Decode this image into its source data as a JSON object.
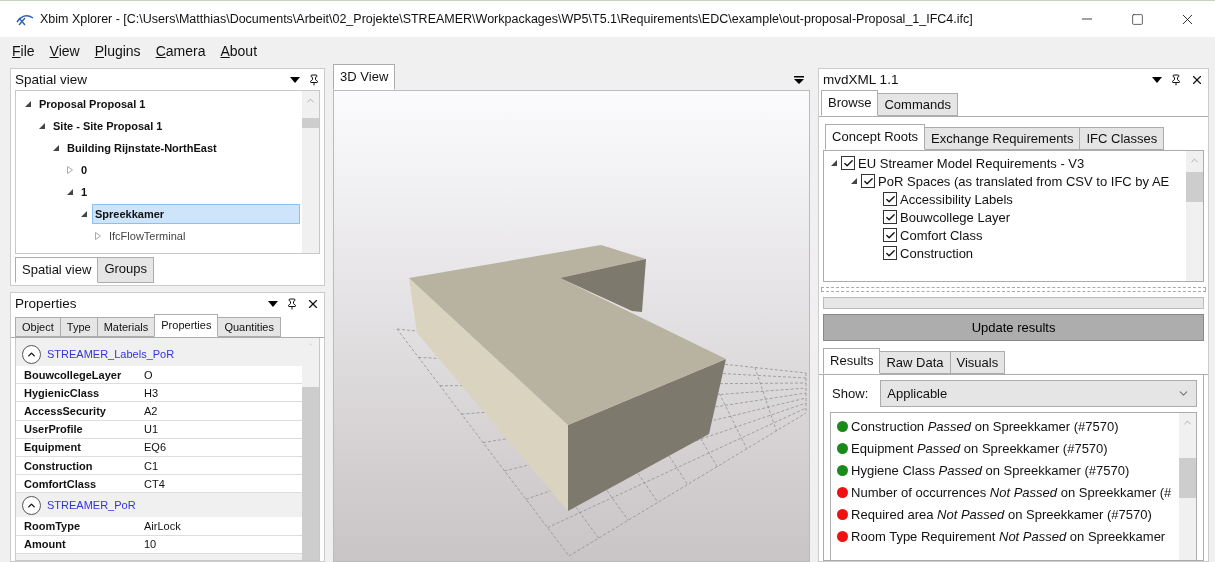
{
  "window": {
    "title": "Xbim Xplorer - [C:\\Users\\Matthias\\Documents\\Arbeit\\02_Projekte\\STREAMER\\Workpackages\\WP5\\T5.1\\Requirements\\EDC\\example\\out-proposal-Proposal_1_IFC4.ifc]"
  },
  "menu": [
    {
      "label": "File"
    },
    {
      "label": "View"
    },
    {
      "label": "Plugins"
    },
    {
      "label": "Camera"
    },
    {
      "label": "About"
    }
  ],
  "spatial_view": {
    "title": "Spatial view",
    "tree": [
      {
        "label": "Proposal Proposal 1",
        "kind": "spatial",
        "expanded": true,
        "selected": false,
        "children": [
          {
            "label": "Site - Site Proposal 1",
            "kind": "spatial",
            "expanded": true,
            "selected": false,
            "children": [
              {
                "label": "Building Rijnstate-NorthEast",
                "kind": "spatial",
                "expanded": true,
                "selected": false,
                "children": [
                  {
                    "label": "0",
                    "kind": "spatial",
                    "expanded": false,
                    "selected": false
                  },
                  {
                    "label": "1",
                    "kind": "spatial",
                    "expanded": true,
                    "selected": false,
                    "children": [
                      {
                        "label": "Spreekkamer",
                        "kind": "spatial",
                        "expanded": true,
                        "selected": true,
                        "children": [
                          {
                            "label": "IfcFlowTerminal",
                            "kind": "element",
                            "expanded": false,
                            "selected": false
                          }
                        ]
                      }
                    ]
                  }
                ]
              }
            ]
          }
        ]
      }
    ],
    "tabs": [
      {
        "label": "Spatial view",
        "selected": true
      },
      {
        "label": "Groups",
        "selected": false
      }
    ]
  },
  "properties": {
    "title": "Properties",
    "tabs": [
      {
        "label": "Object",
        "selected": false
      },
      {
        "label": "Type",
        "selected": false
      },
      {
        "label": "Materials",
        "selected": false
      },
      {
        "label": "Properties",
        "selected": true
      },
      {
        "label": "Quantities",
        "selected": false
      }
    ],
    "groups": [
      {
        "name": "STREAMER_Labels_PoR",
        "expanded": true,
        "rows": [
          {
            "name": "BouwcollegeLayer",
            "value": "O"
          },
          {
            "name": "HygienicClass",
            "value": "H3"
          },
          {
            "name": "AccessSecurity",
            "value": "A2"
          },
          {
            "name": "UserProfile",
            "value": "U1"
          },
          {
            "name": "Equipment",
            "value": "EQ6"
          },
          {
            "name": "Construction",
            "value": "C1"
          },
          {
            "name": "ComfortClass",
            "value": "CT4"
          }
        ]
      },
      {
        "name": "STREAMER_PoR",
        "expanded": true,
        "rows": [
          {
            "name": "RoomType",
            "value": "AirLock"
          },
          {
            "name": "Amount",
            "value": "10"
          }
        ]
      }
    ]
  },
  "view3d": {
    "tab": "3D View"
  },
  "mvdxml": {
    "title": "mvdXML 1.1",
    "tabs": [
      {
        "label": "Browse",
        "selected": true
      },
      {
        "label": "Commands",
        "selected": false
      }
    ],
    "subtabs": [
      {
        "label": "Concept Roots",
        "selected": true
      },
      {
        "label": "Exchange Requirements",
        "selected": false
      },
      {
        "label": "IFC Classes",
        "selected": false
      }
    ],
    "tree": [
      {
        "label": "EU Streamer Model Requirements - V3",
        "checked": true,
        "expanded": true,
        "children": [
          {
            "label": "PoR Spaces (as translated from CSV to IFC by AE",
            "checked": true,
            "expanded": true,
            "children": [
              {
                "label": "Accessibility Labels",
                "checked": true
              },
              {
                "label": "Bouwcollege Layer",
                "checked": true
              },
              {
                "label": "Comfort Class",
                "checked": true
              },
              {
                "label": "Construction",
                "checked": true
              }
            ]
          }
        ]
      }
    ],
    "progress": {
      "level": 0
    },
    "update_button": "Update results",
    "result_tabs": [
      {
        "label": "Results",
        "selected": true
      },
      {
        "label": "Raw Data",
        "selected": false
      },
      {
        "label": "Visuals",
        "selected": false
      }
    ],
    "show_label": "Show:",
    "show_value": "Applicable",
    "results": [
      {
        "text": "Construction  *Passed* on Spreekkamer (#7570)",
        "color": "#1a8a1a"
      },
      {
        "text": "Equipment  *Passed* on Spreekkamer (#7570)",
        "color": "#1a8a1a"
      },
      {
        "text": "Hygiene Class  *Passed* on Spreekkamer (#7570)",
        "color": "#1a8a1a"
      },
      {
        "text": "Number of occurrences  *Not Passed* on Spreekkamer (#",
        "color": "#ee1111"
      },
      {
        "text": "Required area  *Not Passed* on Spreekkamer (#7570)",
        "color": "#ee1111"
      },
      {
        "text": "Room Type Requirement  *Not Passed* on Spreekkamer",
        "color": "#ee1111"
      }
    ]
  }
}
